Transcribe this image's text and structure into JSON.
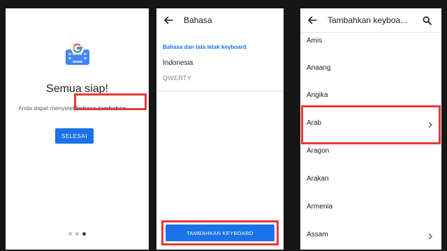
{
  "screen1": {
    "title": "Semua siap!",
    "subtitle_prefix": "Anda dapat menyetel ",
    "subtitle_link": "bahasa tambahan",
    "done_button": "SELESAI",
    "pager": {
      "count": 3,
      "active": 3
    }
  },
  "screen2": {
    "title": "Bahasa",
    "section_header": "Bahasa dan tata letak keyboard",
    "language": "Indonesia",
    "layout": "QWERTY",
    "add_button": "TAMBAHKAN KEYBOARD"
  },
  "screen3": {
    "title": "Tambahkan keyboa...",
    "items": [
      {
        "label": "Amis",
        "chevron": false
      },
      {
        "label": "Anaang",
        "chevron": false
      },
      {
        "label": "Angika",
        "chevron": false
      },
      {
        "label": "Arab",
        "chevron": true
      },
      {
        "label": "Aragon",
        "chevron": false
      },
      {
        "label": "Arakan",
        "chevron": false
      },
      {
        "label": "Armenia",
        "chevron": false
      },
      {
        "label": "Assam",
        "chevron": true
      }
    ]
  },
  "colors": {
    "accent": "#1a73e8",
    "highlight": "#e53935",
    "background": "#161616"
  },
  "icons": [
    "gboard-logo-icon",
    "arrow-back-icon",
    "search-icon",
    "chevron-right-icon"
  ]
}
